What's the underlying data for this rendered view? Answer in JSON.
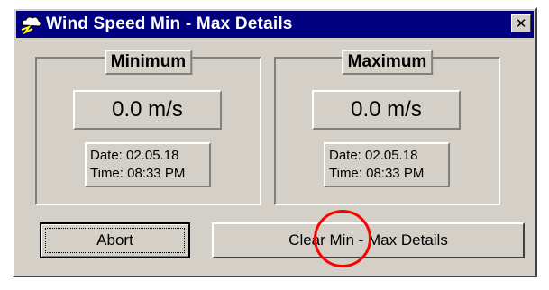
{
  "window": {
    "title": "Wind Speed Min - Max Details",
    "close_label": "✕",
    "app_icon": "weather-app-icon"
  },
  "minimum": {
    "label": "Minimum",
    "value": "0.0 m/s",
    "date": "Date: 02.05.18",
    "time": "Time: 08:33 PM"
  },
  "maximum": {
    "label": "Maximum",
    "value": "0.0 m/s",
    "date": "Date: 02.05.18",
    "time": "Time: 08:33 PM"
  },
  "buttons": {
    "abort_label": "Abort",
    "clear_label": "Clear Min - Max Details"
  },
  "colors": {
    "titlebar": "#000080",
    "face": "#d4d0c8",
    "annotation": "#ff0000"
  }
}
